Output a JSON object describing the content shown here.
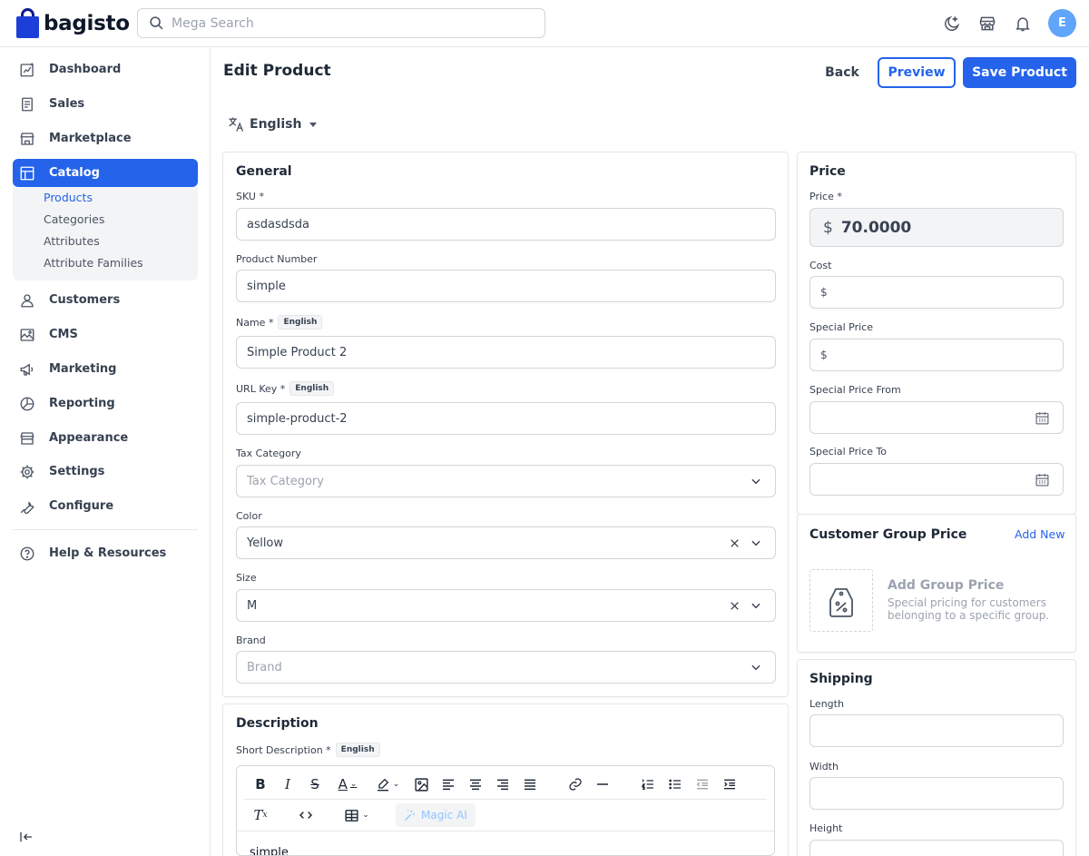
{
  "header": {
    "brand": "bagisto",
    "search_placeholder": "Mega Search",
    "avatar_initial": "E"
  },
  "sidebar": {
    "items": [
      {
        "label": "Dashboard",
        "icon": "dashboard-icon"
      },
      {
        "label": "Sales",
        "icon": "sales-icon"
      },
      {
        "label": "Marketplace",
        "icon": "marketplace-icon"
      },
      {
        "label": "Catalog",
        "icon": "catalog-icon"
      },
      {
        "label": "Customers",
        "icon": "customers-icon"
      },
      {
        "label": "CMS",
        "icon": "cms-icon"
      },
      {
        "label": "Marketing",
        "icon": "marketing-icon"
      },
      {
        "label": "Reporting",
        "icon": "reporting-icon"
      },
      {
        "label": "Appearance",
        "icon": "appearance-icon"
      },
      {
        "label": "Settings",
        "icon": "settings-icon"
      },
      {
        "label": "Configure",
        "icon": "configure-icon"
      },
      {
        "label": "Help & Resources",
        "icon": "help-icon"
      }
    ],
    "catalog_sub": [
      "Products",
      "Categories",
      "Attributes",
      "Attribute Families"
    ],
    "active_item": "Catalog",
    "active_sub": "Products"
  },
  "page": {
    "title": "Edit Product",
    "back_label": "Back",
    "preview_label": "Preview",
    "save_label": "Save Product",
    "locale": "English"
  },
  "general": {
    "title": "General",
    "sku_label": "SKU *",
    "sku_value": "asdasdsda",
    "product_number_label": "Product Number",
    "product_number_value": "simple",
    "name_label": "Name *",
    "name_value": "Simple Product 2",
    "url_key_label": "URL Key *",
    "url_key_value": "simple-product-2",
    "tax_label": "Tax Category",
    "tax_placeholder": "Tax Category",
    "color_label": "Color",
    "color_value": "Yellow",
    "size_label": "Size",
    "size_value": "M",
    "brand_label": "Brand",
    "brand_placeholder": "Brand",
    "locale_badge": "English"
  },
  "description": {
    "title": "Description",
    "short_label": "Short Description *",
    "locale_badge": "English",
    "magic_ai_label": "Magic AI",
    "content": "simple"
  },
  "price": {
    "title": "Price",
    "price_label": "Price *",
    "currency": "$",
    "price_value": "70.0000",
    "cost_label": "Cost",
    "special_price_label": "Special Price",
    "special_from_label": "Special Price From",
    "special_to_label": "Special Price To"
  },
  "customer_group_price": {
    "title": "Customer Group Price",
    "add_new_label": "Add New",
    "empty_title": "Add Group Price",
    "empty_text": "Special pricing for customers belonging to a specific group."
  },
  "shipping": {
    "title": "Shipping",
    "length_label": "Length",
    "width_label": "Width",
    "height_label": "Height"
  },
  "colors": {
    "accent": "#2563eb",
    "border": "#e5e7eb",
    "muted_text": "#9ca3af"
  }
}
